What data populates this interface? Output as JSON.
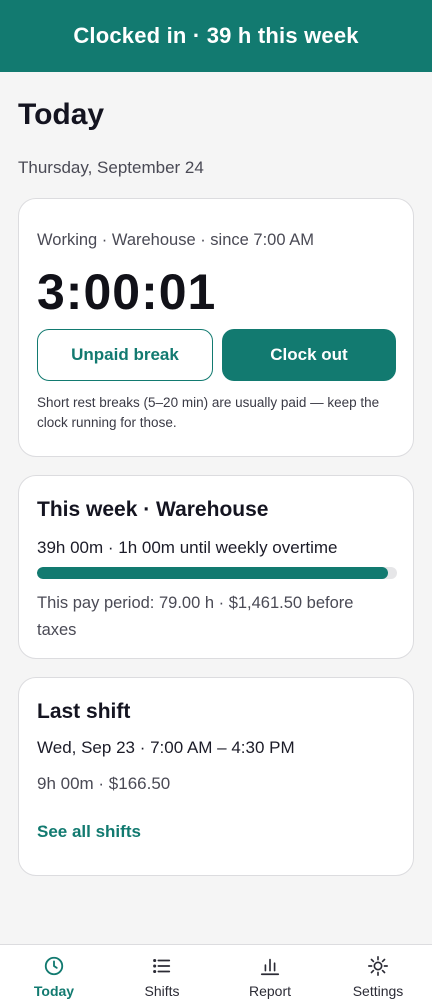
{
  "banner": {
    "text": "Clocked in · 39 h this week"
  },
  "page": {
    "title": "Today",
    "date": "Thursday, September 24"
  },
  "clock_card": {
    "status": "Working · Warehouse · since 7:00 AM",
    "timer": "3:00:01",
    "break_button": "Unpaid break",
    "clockout_button": "Clock out",
    "hint": "Short rest breaks (5–20 min) are usually paid — keep the clock running for those."
  },
  "week_card": {
    "title": "This week · Warehouse",
    "hours": "39h 00m · 1h 00m until weekly overtime",
    "progress_fraction": 0.975,
    "pay_period": "This pay period: 79.00 h · $1,461.50 before taxes"
  },
  "last_shift_card": {
    "title": "Last shift",
    "range": "Wed, Sep 23 · 7:00 AM – 4:30 PM",
    "total": "9h 00m · $166.50",
    "link": "See all shifts"
  },
  "tabs": [
    {
      "label": "Today",
      "icon": "clock-icon",
      "active": true
    },
    {
      "label": "Shifts",
      "icon": "list-icon",
      "active": false
    },
    {
      "label": "Report",
      "icon": "bar-chart-icon",
      "active": false
    },
    {
      "label": "Settings",
      "icon": "sun-gear-icon",
      "active": false
    }
  ],
  "colors": {
    "accent": "#127a70",
    "background": "#f5f5f5",
    "card": "#ffffff"
  }
}
